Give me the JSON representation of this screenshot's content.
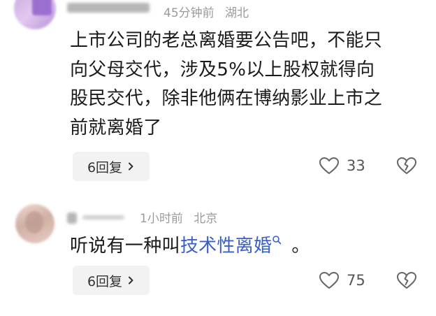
{
  "comments": [
    {
      "time": "45分钟前",
      "location": "湖北",
      "lines": [
        "上市公司的老总离婚要公告吧，不能只",
        "向父母交代，涉及5%以上股权就得向",
        "股民交代，除非他俩在博纳影业上市之",
        "前就离婚了"
      ],
      "reply_label": "6回复",
      "like_count": "33"
    },
    {
      "time": "1小时前",
      "location": "北京",
      "text_before": "听说有一种叫",
      "link_text": "技术性离婚",
      "text_after": "。",
      "reply_label": "6回复",
      "like_count": "75"
    }
  ],
  "icons": {
    "like": "heart-outline-icon",
    "dislike": "broken-heart-icon",
    "reply_arrow": "chevron-right-icon",
    "link_search": "search-icon"
  },
  "colors": {
    "link": "#3a5fc8",
    "meta": "#9a9a9a",
    "pill_bg": "#f2f2f2"
  }
}
